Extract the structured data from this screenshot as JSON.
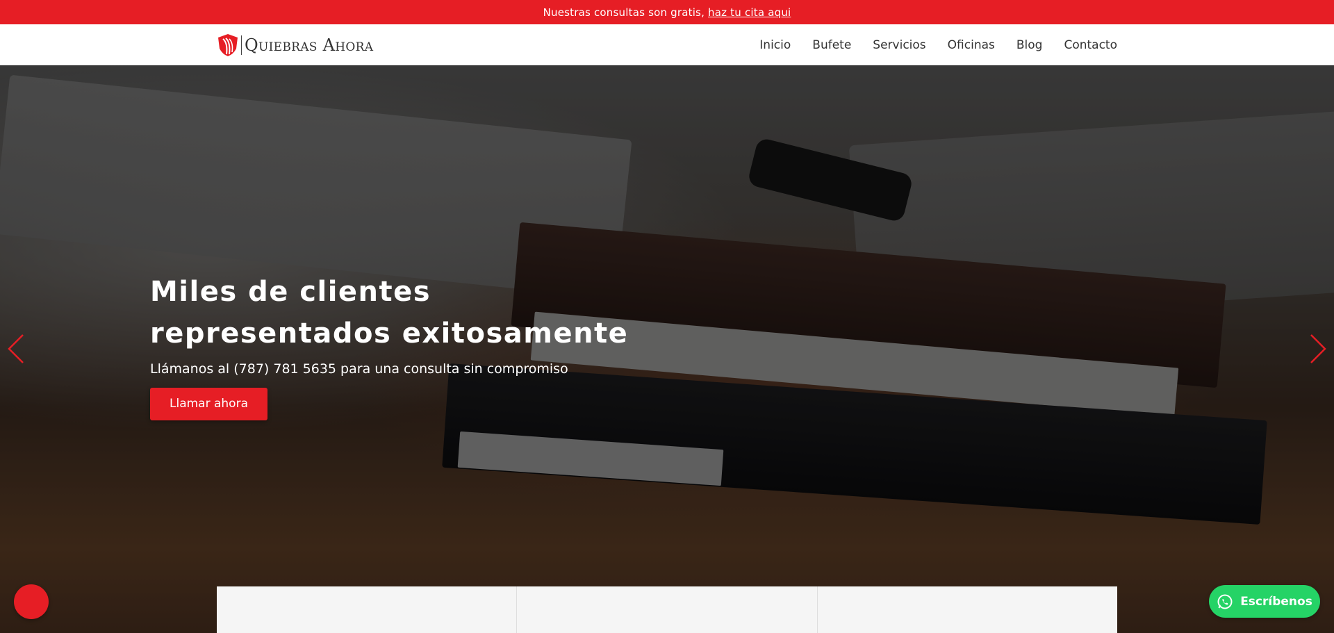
{
  "topbar": {
    "text": "Nuestras consultas son gratis,",
    "link_text": "haz tu cita aqui"
  },
  "header": {
    "logo_text": "Quiebras Ahora",
    "nav": [
      {
        "label": "Inicio"
      },
      {
        "label": "Bufete"
      },
      {
        "label": "Servicios"
      },
      {
        "label": "Oficinas"
      },
      {
        "label": "Blog"
      },
      {
        "label": "Contacto"
      }
    ]
  },
  "hero": {
    "title_line1": "Miles de clientes",
    "title_line2": "representados exitosamente",
    "subtitle": "Llámanos al (787) 781 5635 para una consulta sin compromiso",
    "button_label": "Llamar ahora"
  },
  "whatsapp": {
    "label": "Escríbenos",
    "icon": "whatsapp-icon"
  },
  "colors": {
    "brand_red": "#e61e25",
    "whatsapp_green": "#25d366"
  }
}
